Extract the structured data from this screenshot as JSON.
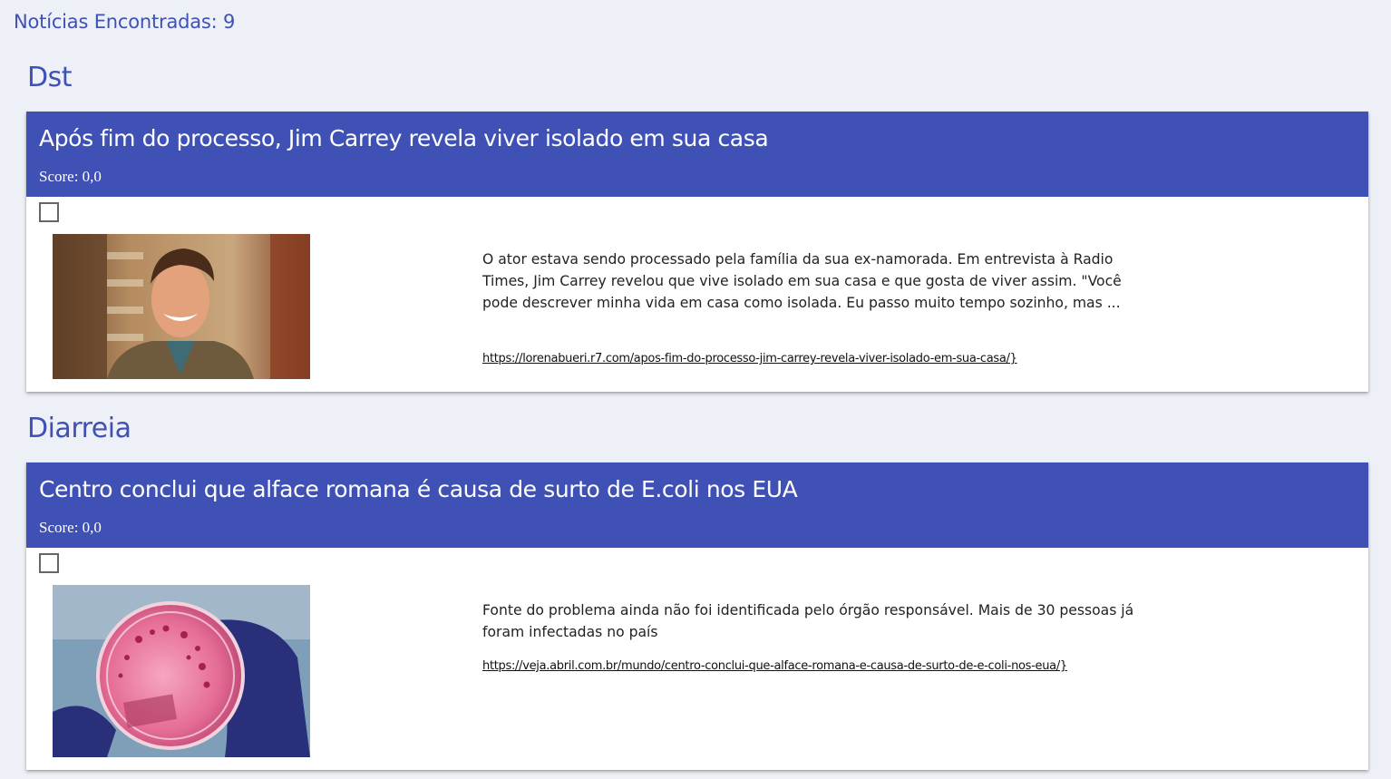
{
  "summary": {
    "found_label": "Notícias Encontradas: 9"
  },
  "groups": [
    {
      "category": "Dst",
      "article": {
        "title": "Após fim do processo, Jim Carrey revela viver isolado em sua casa",
        "score": "Score: 0,0",
        "description": "O ator estava sendo processado pela família da sua ex-namorada. Em entrevista à Radio Times, Jim Carrey revelou que vive isolado em sua casa e que gosta de viver assim. \"Você pode descrever minha vida em casa como isolada. Eu passo muito tempo sozinho, mas ...",
        "link": "https://lorenabueri.r7.com/apos-fim-do-processo-jim-carrey-revela-viver-isolado-em-sua-casa/}"
      }
    },
    {
      "category": "Diarreia",
      "article": {
        "title": "Centro conclui que alface romana é causa de surto de E.coli nos EUA",
        "score": "Score: 0,0",
        "description": "Fonte do problema ainda não foi identificada pelo órgão responsável. Mais de 30 pessoas já foram infectadas no país",
        "link": "https://veja.abril.com.br/mundo/centro-conclui-que-alface-romana-e-causa-de-surto-de-e-coli-nos-eua/}"
      }
    }
  ],
  "colors": {
    "accent": "#3f51b5",
    "background": "#eef0f7"
  }
}
